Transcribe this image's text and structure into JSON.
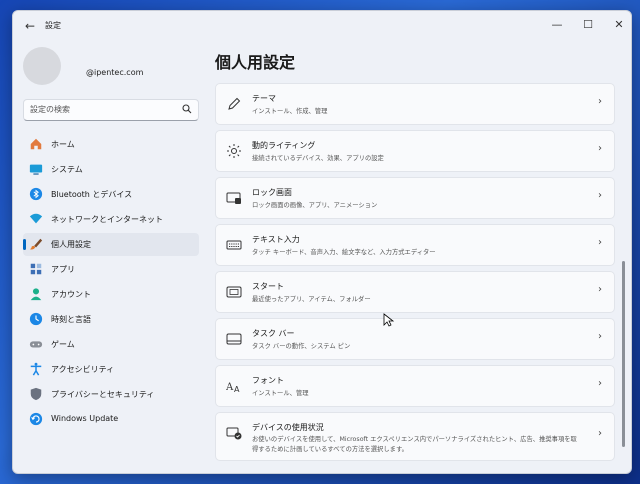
{
  "window": {
    "title": "設定"
  },
  "sidebar": {
    "user_email": "@ipentec.com",
    "search_placeholder": "設定の検索",
    "items": [
      {
        "label": "ホーム",
        "icon": "home-icon",
        "color": "#e27a3f"
      },
      {
        "label": "システム",
        "icon": "system-display-icon",
        "color": "#1b9bd7"
      },
      {
        "label": "Bluetooth とデバイス",
        "icon": "bluetooth-icon",
        "color": "#1b87e6"
      },
      {
        "label": "ネットワークとインターネット",
        "icon": "wifi-icon",
        "color": "#1b9bd7"
      },
      {
        "label": "個人用設定",
        "icon": "paintbrush-icon",
        "color": "#e07a2e",
        "active": true
      },
      {
        "label": "アプリ",
        "icon": "apps-icon",
        "color": "#3d6fb5"
      },
      {
        "label": "アカウント",
        "icon": "person-icon",
        "color": "#1bb08a"
      },
      {
        "label": "時刻と言語",
        "icon": "globe-clock-icon",
        "color": "#1b87e6"
      },
      {
        "label": "ゲーム",
        "icon": "gamepad-icon",
        "color": "#8a8f97"
      },
      {
        "label": "アクセシビリティ",
        "icon": "accessibility-icon",
        "color": "#1b87e6"
      },
      {
        "label": "プライバシーとセキュリティ",
        "icon": "shield-icon",
        "color": "#6b7280"
      },
      {
        "label": "Windows Update",
        "icon": "update-icon",
        "color": "#1b87e6"
      }
    ]
  },
  "main": {
    "title": "個人用設定",
    "cards": [
      {
        "title": "テーマ",
        "subtitle": "インストール、作成、管理",
        "icon": "pen-icon"
      },
      {
        "title": "動的ライティング",
        "subtitle": "接続されているデバイス、効果、アプリの設定",
        "icon": "sun-light-icon"
      },
      {
        "title": "ロック画面",
        "subtitle": "ロック画面の画像、アプリ、アニメーション",
        "icon": "lock-screen-icon"
      },
      {
        "title": "テキスト入力",
        "subtitle": "タッチ キーボード、音声入力、絵文字など、入力方式エディター",
        "icon": "keyboard-icon"
      },
      {
        "title": "スタート",
        "subtitle": "最近使ったアプリ、アイテム、フォルダー",
        "icon": "start-menu-icon"
      },
      {
        "title": "タスク バー",
        "subtitle": "タスク バーの動作、システム ピン",
        "icon": "taskbar-icon"
      },
      {
        "title": "フォント",
        "subtitle": "インストール、管理",
        "icon": "font-icon"
      },
      {
        "title": "デバイスの使用状況",
        "subtitle": "お使いのデバイスを使用して、Microsoft エクスペリエンス内でパーソナライズされたヒント、広告、推奨事項を取得するために計画しているすべての方法を選択します。",
        "icon": "device-usage-icon"
      }
    ]
  }
}
